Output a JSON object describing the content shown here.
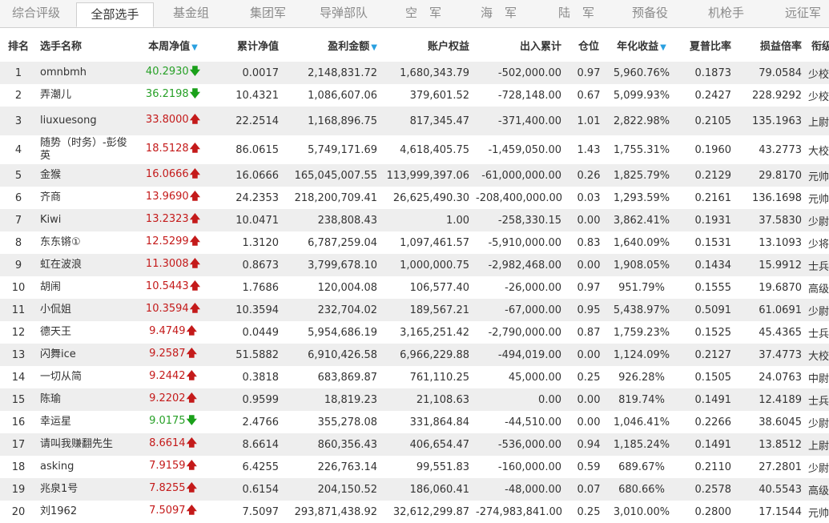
{
  "tabs": [
    "综合评级",
    "全部选手",
    "基金组",
    "集团军",
    "导弹部队",
    "空　军",
    "海　军",
    "陆　军",
    "预备役",
    "机枪手",
    "远征军"
  ],
  "headers": {
    "rank": "排名",
    "name": "选手名称",
    "weekly_nav": "本周净值",
    "cumulative_nav": "累计净值",
    "profit": "盈利金额",
    "equity": "账户权益",
    "inout": "出入累计",
    "position": "仓位",
    "annual": "年化收益",
    "sharpe": "夏普比率",
    "pl_ratio": "损益倍率",
    "rank_title": "衔级"
  },
  "sort_icon": "▼",
  "arrow_up": "🡅",
  "arrow_down": "🡇",
  "colors": {
    "up": "#c41a1a",
    "down": "#27a027",
    "sort": "#2aa0e0"
  },
  "rows": [
    {
      "rank": "1",
      "name": "omnbmh",
      "nav": "40.2930",
      "dir": "down",
      "cum": "0.0017",
      "profit": "2,148,831.72",
      "equity": "1,680,343.79",
      "inout": "-502,000.00",
      "pos": "0.97",
      "annual": "5,960.76%",
      "sharpe": "0.1873",
      "pl": "79.0584",
      "title": "少校"
    },
    {
      "rank": "2",
      "name": "弄潮儿",
      "nav": "36.2198",
      "dir": "down",
      "cum": "10.4321",
      "profit": "1,086,607.06",
      "equity": "379,601.52",
      "inout": "-728,148.00",
      "pos": "0.67",
      "annual": "5,099.93%",
      "sharpe": "0.2427",
      "pl": "228.9292",
      "title": "少校"
    },
    {
      "rank": "3",
      "name": "liuxuesong",
      "nav": "33.8000",
      "dir": "up",
      "cum": "22.2514",
      "profit": "1,168,896.75",
      "equity": "817,345.47",
      "inout": "-371,400.00",
      "pos": "1.01",
      "annual": "2,822.98%",
      "sharpe": "0.2105",
      "pl": "135.1963",
      "title": "上尉"
    },
    {
      "rank": "4",
      "name": "随势（时务）-彭俊英",
      "nav": "18.5128",
      "dir": "up",
      "cum": "86.0615",
      "profit": "5,749,171.69",
      "equity": "4,618,405.75",
      "inout": "-1,459,050.00",
      "pos": "1.43",
      "annual": "1,755.31%",
      "sharpe": "0.1960",
      "pl": "43.2773",
      "title": "大校"
    },
    {
      "rank": "5",
      "name": "金猴",
      "nav": "16.0666",
      "dir": "up",
      "cum": "16.0666",
      "profit": "165,045,007.55",
      "equity": "113,999,397.06",
      "inout": "-61,000,000.00",
      "pos": "0.26",
      "annual": "1,825.79%",
      "sharpe": "0.2129",
      "pl": "29.8170",
      "title": "元帅"
    },
    {
      "rank": "6",
      "name": "齐商",
      "nav": "13.9690",
      "dir": "up",
      "cum": "24.2353",
      "profit": "218,200,709.41",
      "equity": "26,625,490.30",
      "inout": "-208,400,000.00",
      "pos": "0.03",
      "annual": "1,293.59%",
      "sharpe": "0.2161",
      "pl": "136.1698",
      "title": "元帅"
    },
    {
      "rank": "7",
      "name": "Kiwi",
      "nav": "13.2323",
      "dir": "up",
      "cum": "10.0471",
      "profit": "238,808.43",
      "equity": "1.00",
      "inout": "-258,330.15",
      "pos": "0.00",
      "annual": "3,862.41%",
      "sharpe": "0.1931",
      "pl": "37.5830",
      "title": "少尉"
    },
    {
      "rank": "8",
      "name": "东东锵①",
      "nav": "12.5299",
      "dir": "up",
      "cum": "1.3120",
      "profit": "6,787,259.04",
      "equity": "1,097,461.57",
      "inout": "-5,910,000.00",
      "pos": "0.83",
      "annual": "1,640.09%",
      "sharpe": "0.1531",
      "pl": "13.1093",
      "title": "少将"
    },
    {
      "rank": "9",
      "name": "虹在波浪",
      "nav": "11.3008",
      "dir": "up",
      "cum": "0.8673",
      "profit": "3,799,678.10",
      "equity": "1,000,000.75",
      "inout": "-2,982,468.00",
      "pos": "0.00",
      "annual": "1,908.05%",
      "sharpe": "0.1434",
      "pl": "15.9912",
      "title": "士兵"
    },
    {
      "rank": "10",
      "name": "胡闹",
      "nav": "10.5443",
      "dir": "up",
      "cum": "1.7686",
      "profit": "120,004.08",
      "equity": "106,577.40",
      "inout": "-26,000.00",
      "pos": "0.97",
      "annual": "951.79%",
      "sharpe": "0.1555",
      "pl": "19.6870",
      "title": "高级士官"
    },
    {
      "rank": "11",
      "name": "小侃姐",
      "nav": "10.3594",
      "dir": "up",
      "cum": "10.3594",
      "profit": "232,704.02",
      "equity": "189,567.21",
      "inout": "-67,000.00",
      "pos": "0.95",
      "annual": "5,438.97%",
      "sharpe": "0.5091",
      "pl": "61.0691",
      "title": "少尉"
    },
    {
      "rank": "12",
      "name": "德天王",
      "nav": "9.4749",
      "dir": "up",
      "cum": "0.0449",
      "profit": "5,954,686.19",
      "equity": "3,165,251.42",
      "inout": "-2,790,000.00",
      "pos": "0.87",
      "annual": "1,759.23%",
      "sharpe": "0.1525",
      "pl": "45.4365",
      "title": "士兵"
    },
    {
      "rank": "13",
      "name": "闪舞ice",
      "nav": "9.2587",
      "dir": "up",
      "cum": "51.5882",
      "profit": "6,910,426.58",
      "equity": "6,966,229.88",
      "inout": "-494,019.00",
      "pos": "0.00",
      "annual": "1,124.09%",
      "sharpe": "0.2127",
      "pl": "37.4773",
      "title": "大校"
    },
    {
      "rank": "14",
      "name": "一切从简",
      "nav": "9.2442",
      "dir": "up",
      "cum": "0.3818",
      "profit": "683,869.87",
      "equity": "761,110.25",
      "inout": "45,000.00",
      "pos": "0.25",
      "annual": "926.28%",
      "sharpe": "0.1505",
      "pl": "24.0763",
      "title": "中尉"
    },
    {
      "rank": "15",
      "name": "陈瑜",
      "nav": "9.2202",
      "dir": "up",
      "cum": "0.9599",
      "profit": "18,819.23",
      "equity": "21,108.63",
      "inout": "0.00",
      "pos": "0.00",
      "annual": "819.74%",
      "sharpe": "0.1491",
      "pl": "12.4189",
      "title": "士兵"
    },
    {
      "rank": "16",
      "name": "幸运星",
      "nav": "9.0175",
      "dir": "down",
      "cum": "2.4766",
      "profit": "355,278.08",
      "equity": "331,864.84",
      "inout": "-44,510.00",
      "pos": "0.00",
      "annual": "1,046.41%",
      "sharpe": "0.2266",
      "pl": "38.6045",
      "title": "少尉"
    },
    {
      "rank": "17",
      "name": "请叫我赚翻先生",
      "nav": "8.6614",
      "dir": "up",
      "cum": "8.6614",
      "profit": "860,356.43",
      "equity": "406,654.47",
      "inout": "-536,000.00",
      "pos": "0.94",
      "annual": "1,185.24%",
      "sharpe": "0.1491",
      "pl": "13.8512",
      "title": "上尉"
    },
    {
      "rank": "18",
      "name": "asking",
      "nav": "7.9159",
      "dir": "up",
      "cum": "6.4255",
      "profit": "226,763.14",
      "equity": "99,551.83",
      "inout": "-160,000.00",
      "pos": "0.59",
      "annual": "689.67%",
      "sharpe": "0.2110",
      "pl": "27.2801",
      "title": "少尉"
    },
    {
      "rank": "19",
      "name": "兆泉1号",
      "nav": "7.8255",
      "dir": "up",
      "cum": "0.6154",
      "profit": "204,150.52",
      "equity": "186,060.41",
      "inout": "-48,000.00",
      "pos": "0.07",
      "annual": "680.66%",
      "sharpe": "0.2578",
      "pl": "40.5543",
      "title": "高级士官"
    },
    {
      "rank": "20",
      "name": "刘1962",
      "nav": "7.5097",
      "dir": "up",
      "cum": "7.5097",
      "profit": "293,871,438.92",
      "equity": "32,612,299.87",
      "inout": "-274,983,841.00",
      "pos": "0.25",
      "annual": "3,010.00%",
      "sharpe": "0.2800",
      "pl": "17.1544",
      "title": "元帅"
    }
  ]
}
